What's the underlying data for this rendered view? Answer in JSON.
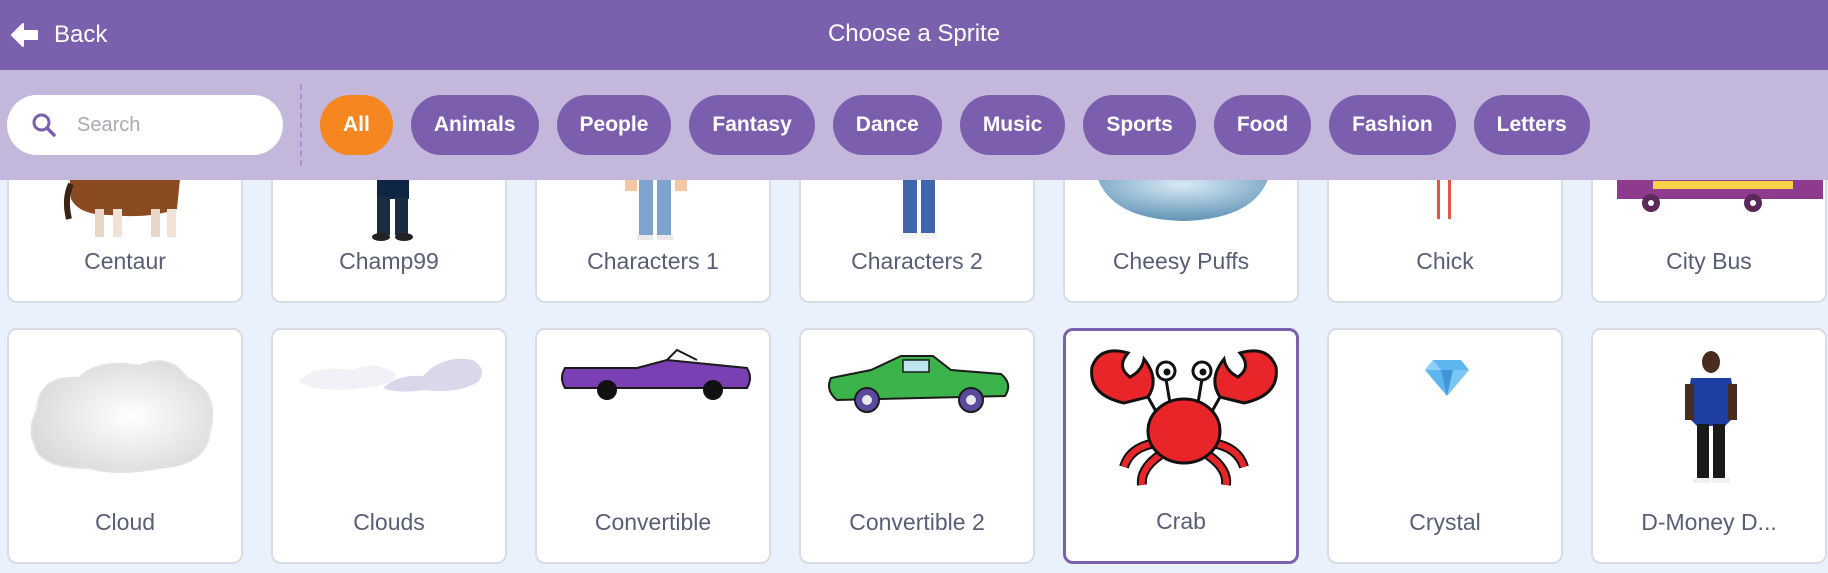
{
  "header": {
    "back_label": "Back",
    "title": "Choose a Sprite"
  },
  "search": {
    "placeholder": "Search",
    "value": ""
  },
  "tags": [
    {
      "label": "All",
      "active": true
    },
    {
      "label": "Animals",
      "active": false
    },
    {
      "label": "People",
      "active": false
    },
    {
      "label": "Fantasy",
      "active": false
    },
    {
      "label": "Dance",
      "active": false
    },
    {
      "label": "Music",
      "active": false
    },
    {
      "label": "Sports",
      "active": false
    },
    {
      "label": "Food",
      "active": false
    },
    {
      "label": "Fashion",
      "active": false
    },
    {
      "label": "Letters",
      "active": false
    }
  ],
  "sprites_row1": [
    {
      "name": "Centaur",
      "thumbnail": "centaur-legs"
    },
    {
      "name": "Champ99",
      "thumbnail": "person-legs-dark"
    },
    {
      "name": "Characters 1",
      "thumbnail": "person-legs-jeans"
    },
    {
      "name": "Characters 2",
      "thumbnail": "person-legs-yellow"
    },
    {
      "name": "Cheesy Puffs",
      "thumbnail": "blue-bowl"
    },
    {
      "name": "Chick",
      "thumbnail": "chick-legs"
    },
    {
      "name": "City Bus",
      "thumbnail": "purple-bus"
    }
  ],
  "sprites_row2": [
    {
      "name": "Cloud",
      "thumbnail": "cloud",
      "selected": false
    },
    {
      "name": "Clouds",
      "thumbnail": "thin-clouds",
      "selected": false
    },
    {
      "name": "Convertible",
      "thumbnail": "purple-convertible",
      "selected": false
    },
    {
      "name": "Convertible 2",
      "thumbnail": "green-convertible",
      "selected": false
    },
    {
      "name": "Crab",
      "thumbnail": "red-crab",
      "selected": true
    },
    {
      "name": "Crystal",
      "thumbnail": "blue-crystal",
      "selected": false
    },
    {
      "name": "D-Money D...",
      "thumbnail": "boy-blue-shirt",
      "selected": false
    }
  ],
  "colors": {
    "header_bg": "#7b61ad",
    "filter_bg": "#c3b7dc",
    "tag_bg": "#7b5fae",
    "tag_active_bg": "#f6861f",
    "page_bg": "#e9f1fc",
    "selected_border": "#7b61ad"
  }
}
